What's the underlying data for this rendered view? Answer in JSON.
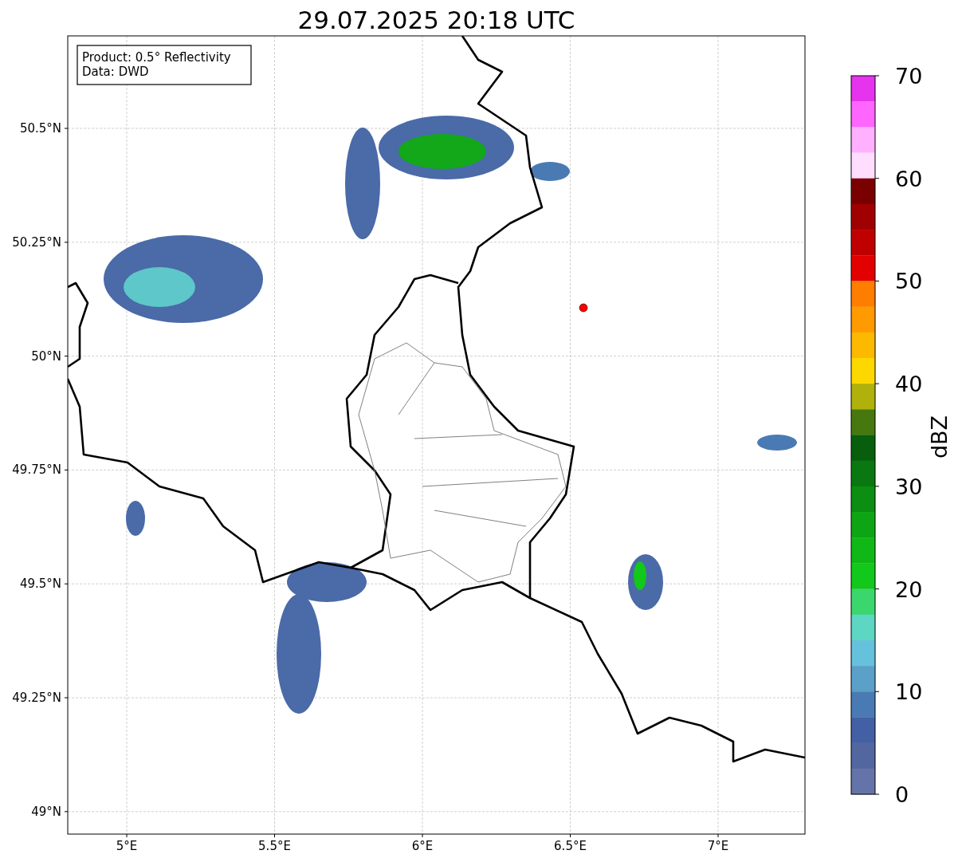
{
  "title": "29.07.2025 20:18 UTC",
  "info": [
    "Product: 0.5° Reflectivity",
    "Data: DWD"
  ],
  "map": {
    "x_tick_labels": [
      "5°E",
      "5.5°E",
      "6°E",
      "6.5°E",
      "7°E"
    ],
    "y_tick_labels": [
      "50.5°N",
      "50.25°N",
      "50°N",
      "49.75°N",
      "49.5°N",
      "49.25°N",
      "49°N"
    ]
  },
  "colorbar": {
    "label": "dBZ",
    "tick_labels": [
      "70",
      "60",
      "50",
      "40",
      "30",
      "20",
      "10",
      "0"
    ],
    "bins": [
      {
        "color": "#e633ee"
      },
      {
        "color": "#ff66ff"
      },
      {
        "color": "#ffb0ff"
      },
      {
        "color": "#ffddff"
      },
      {
        "color": "#7a0000"
      },
      {
        "color": "#a00000"
      },
      {
        "color": "#c00000"
      },
      {
        "color": "#e30000"
      },
      {
        "color": "#ff7e00"
      },
      {
        "color": "#ff9a00"
      },
      {
        "color": "#fdb800"
      },
      {
        "color": "#fdd800"
      },
      {
        "color": "#b0b10a"
      },
      {
        "color": "#47770f"
      },
      {
        "color": "#075e0c"
      },
      {
        "color": "#0a7810"
      },
      {
        "color": "#0b8e12"
      },
      {
        "color": "#0ea514"
      },
      {
        "color": "#0fb816"
      },
      {
        "color": "#12c81a"
      },
      {
        "color": "#3cd66e"
      },
      {
        "color": "#5ed6c4"
      },
      {
        "color": "#66c1dd"
      },
      {
        "color": "#5aa0c8"
      },
      {
        "color": "#4a7ab3"
      },
      {
        "color": "#4460a4"
      },
      {
        "color": "#5266a0"
      },
      {
        "color": "#6574a8"
      }
    ]
  }
}
